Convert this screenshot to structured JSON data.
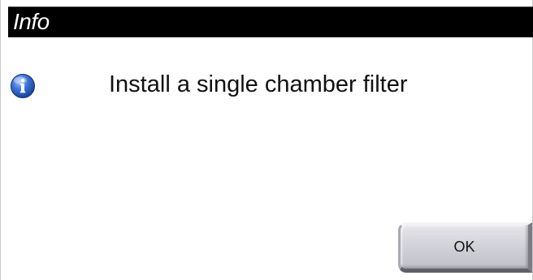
{
  "dialog": {
    "title": "Info",
    "icon": "info-icon",
    "message": "Install a single chamber filter",
    "ok_label": "OK"
  },
  "colors": {
    "titlebar_bg": "#000000",
    "title_text": "#ffffff",
    "icon_blue": "#2a5fc2"
  }
}
